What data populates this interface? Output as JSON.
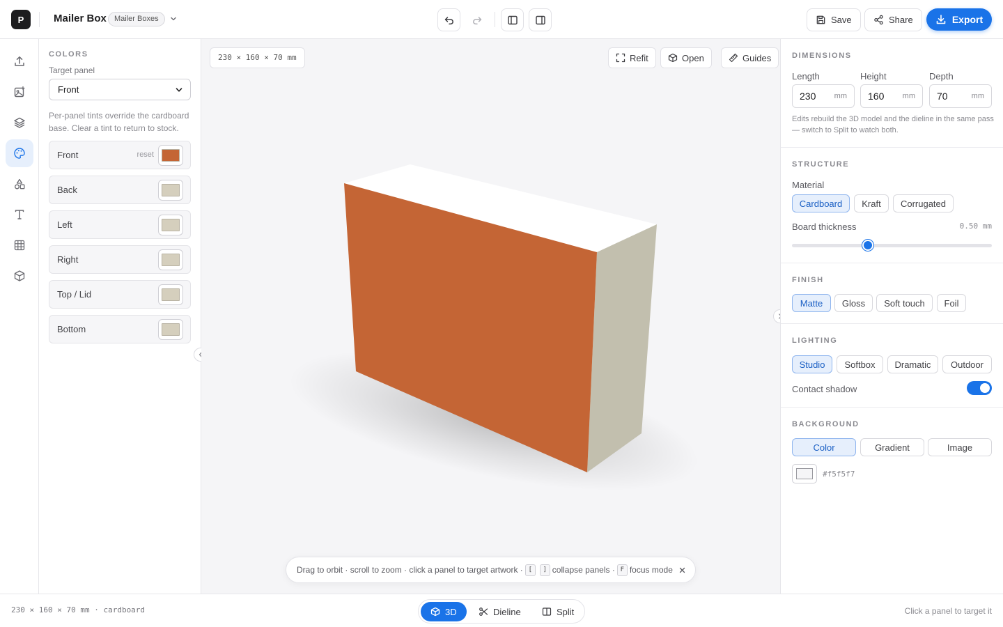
{
  "app": {
    "logo_letter": "P",
    "project_title": "Mailer Box",
    "project_badge": "Mailer Boxes"
  },
  "toolbar": {
    "undo_icon": "undo-icon",
    "redo_icon": "redo-icon",
    "toggle_left_icon": "panel-left-icon",
    "toggle_right_icon": "panel-right-icon",
    "save_label": "Save",
    "share_label": "Share",
    "export_label": "Export"
  },
  "rail": {
    "items": [
      {
        "name": "upload",
        "icon": "upload-icon",
        "active": false
      },
      {
        "name": "image",
        "icon": "image-plus-icon",
        "active": false
      },
      {
        "name": "layers",
        "icon": "layers-icon",
        "active": false
      },
      {
        "name": "colors",
        "icon": "palette-icon",
        "active": true
      },
      {
        "name": "shapes",
        "icon": "shapes-icon",
        "active": false
      },
      {
        "name": "text",
        "icon": "text-icon",
        "active": false
      },
      {
        "name": "grid",
        "icon": "grid-icon",
        "active": false
      },
      {
        "name": "box",
        "icon": "box-icon",
        "active": false
      }
    ]
  },
  "left_panel": {
    "section_title": "COLORS",
    "target_label": "Target panel",
    "target_value": "Front",
    "help": "Per-panel tints override the cardboard base. Clear a tint to return to stock.",
    "reset_label": "reset",
    "panels": [
      {
        "label": "Front",
        "color": "#c46535",
        "has_reset": true
      },
      {
        "label": "Back",
        "color": "#d5cfbd",
        "has_reset": false
      },
      {
        "label": "Left",
        "color": "#d5cfbd",
        "has_reset": false
      },
      {
        "label": "Right",
        "color": "#d5cfbd",
        "has_reset": false
      },
      {
        "label": "Top / Lid",
        "color": "#d5cfbd",
        "has_reset": false
      },
      {
        "label": "Bottom",
        "color": "#d5cfbd",
        "has_reset": false
      }
    ]
  },
  "viewport": {
    "dims_tag": "230 × 160 × 70 mm",
    "refit_label": "Refit",
    "open_label": "Open",
    "guides_label": "Guides",
    "background": "#f5f5f7",
    "box_colors": {
      "front": "#c46535",
      "side": "#c2bfae",
      "top": "#ffffff"
    },
    "hint": {
      "part1": "Drag to orbit · scroll to zoom · click a panel to target artwork ·",
      "key1": "[",
      "key2": "]",
      "part2": "collapse panels ·",
      "key3": "F",
      "part3": "focus mode"
    }
  },
  "right_panel": {
    "dimensions": {
      "title": "DIMENSIONS",
      "length_label": "Length",
      "length_value": "230",
      "height_label": "Height",
      "height_value": "160",
      "depth_label": "Depth",
      "depth_value": "70",
      "unit": "mm",
      "help": "Edits rebuild the 3D model and the dieline in the same pass — switch to Split to watch both."
    },
    "structure": {
      "title": "STRUCTURE",
      "material_label": "Material",
      "materials": [
        "Cardboard",
        "Kraft",
        "Corrugated"
      ],
      "selected_material": "Cardboard",
      "thickness_label": "Board thickness",
      "thickness_value": "0.50 mm",
      "thickness_fraction": 0.38
    },
    "finish": {
      "title": "FINISH",
      "options": [
        "Matte",
        "Gloss",
        "Soft touch",
        "Foil"
      ],
      "selected": "Matte"
    },
    "lighting": {
      "title": "LIGHTING",
      "options": [
        "Studio",
        "Softbox",
        "Dramatic",
        "Outdoor"
      ],
      "selected": "Studio",
      "contact_shadow_label": "Contact shadow",
      "contact_shadow_on": true
    },
    "background": {
      "title": "BACKGROUND",
      "options": [
        "Color",
        "Gradient",
        "Image"
      ],
      "selected": "Color",
      "color_value": "#f5f5f7"
    }
  },
  "bottom": {
    "status_left": "230 × 160 × 70 mm · cardboard",
    "modes": [
      "3D",
      "Dieline",
      "Split"
    ],
    "active_mode": "3D",
    "status_right": "Click a panel to target it"
  },
  "colors": {
    "accent": "#1a73e8",
    "selected_bg": "#e6effc"
  }
}
